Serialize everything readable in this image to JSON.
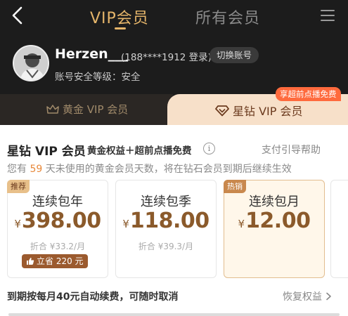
{
  "nav": {
    "tab_vip": "VIP会员",
    "tab_all": "所有会员"
  },
  "user": {
    "name": "Herzen___",
    "phone": "(188****1912 登录)",
    "switch_label": "切换账号",
    "security": "账号安全等级：安全"
  },
  "member_tabs": {
    "gold": "黄金 VIP 会员",
    "diamond": "星钻 VIP 会员",
    "diamond_badge": "享超前点播免费"
  },
  "section": {
    "title": "星钻 VIP 会员",
    "subtitle": "黄金权益＋超前点播免费",
    "help": "支付引导帮助",
    "notice_prefix": "您有",
    "notice_days": "59",
    "notice_suffix": "天未使用的黄金会员天数，将在钻石会员到期后继续生效"
  },
  "plans": [
    {
      "tag": "推荐",
      "name": "连续包年",
      "currency": "¥",
      "price": "398.00",
      "equiv": "折合 ¥33.2/月",
      "save": "立省 220 元",
      "selected": false
    },
    {
      "name": "连续包季",
      "currency": "¥",
      "price": "118.00",
      "equiv": "折合 ¥39.3/月",
      "selected": false
    },
    {
      "tag": "热销",
      "name": "连续包月",
      "currency": "¥",
      "price": "12.00",
      "selected": true
    }
  ],
  "footer": {
    "renew_text": "到期按每月40元自动续费，可随时取消",
    "restore": "恢复权益"
  },
  "colors": {
    "dark_bg": "#1c1c1c",
    "gold_accent": "#e5b56a",
    "price_brown": "#8b5a2b",
    "badge_orange": "#ff6a3d",
    "highlight_orange": "#e8893b"
  },
  "icons": [
    "back-icon",
    "menu-icon",
    "crown-icon",
    "diamond-icon",
    "info-icon",
    "thumb-up-icon",
    "chevron-right-icon"
  ]
}
